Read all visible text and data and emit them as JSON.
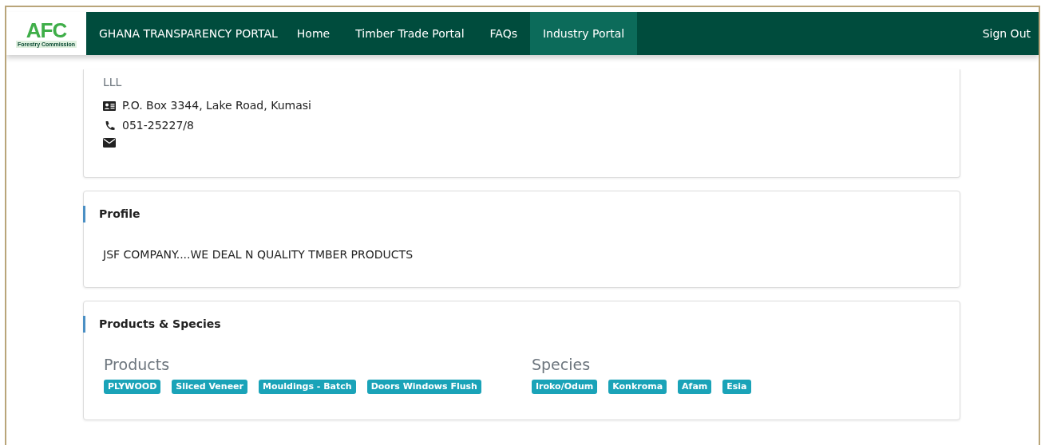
{
  "logo": {
    "mark": "AFC",
    "caption": "Forestry Commission"
  },
  "navbar": {
    "brand": "GHANA TRANSPARENCY PORTAL",
    "items": [
      {
        "label": "Home",
        "selected": false
      },
      {
        "label": "Timber Trade Portal",
        "selected": false
      },
      {
        "label": "FAQs",
        "selected": false
      },
      {
        "label": "Industry Portal",
        "selected": true
      }
    ],
    "sign_out": "Sign Out"
  },
  "contact": {
    "name": "LLL",
    "address": "P.O. Box 3344, Lake Road, Kumasi",
    "phone": "051-25227/8"
  },
  "profile": {
    "title": "Profile",
    "text": "JSF COMPANY....WE DEAL N QUALITY TMBER PRODUCTS"
  },
  "products_species": {
    "title": "Products & Species",
    "groups": [
      {
        "heading": "Products",
        "tags": [
          "PLYWOOD",
          "Sliced Veneer",
          "Mouldings - Batch",
          "Doors Windows Flush"
        ]
      },
      {
        "heading": "Species",
        "tags": [
          "Iroko/Odum",
          "Konkroma",
          "Afam",
          "Esia"
        ]
      }
    ]
  }
}
